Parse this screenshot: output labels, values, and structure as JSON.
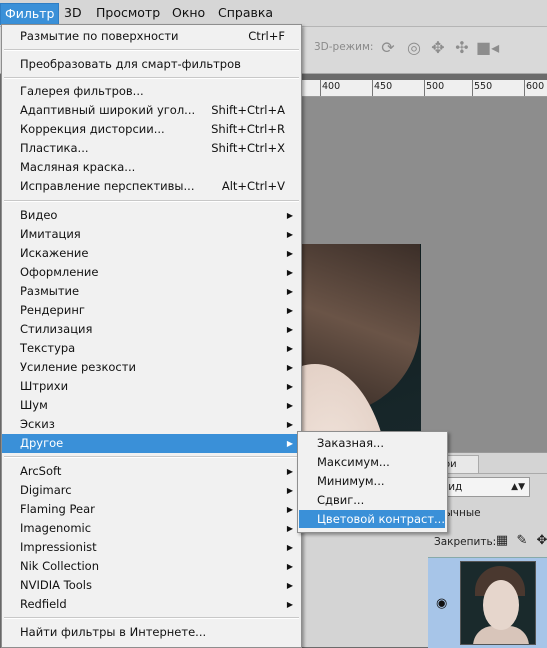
{
  "menubar": {
    "items": [
      "Фильтр",
      "3D",
      "Просмотр",
      "Окно",
      "Справка"
    ]
  },
  "options_bar": {
    "mode_label": "3D-режим:",
    "icons": [
      "rotate-3d-icon",
      "roll-3d-icon",
      "pan-3d-icon",
      "slide-3d-icon",
      "scale-3d-icon"
    ]
  },
  "ruler": {
    "labels": [
      "400",
      "450",
      "500",
      "550",
      "600"
    ]
  },
  "filter_menu": {
    "items": [
      {
        "label": "Размытие по поверхности",
        "shortcut": "Ctrl+F"
      },
      {
        "label": "Преобразовать для смарт-фильтров"
      },
      {
        "label": "Галерея фильтров..."
      },
      {
        "label": "Адаптивный широкий угол...",
        "shortcut": "Shift+Ctrl+A"
      },
      {
        "label": "Коррекция дисторсии...",
        "shortcut": "Shift+Ctrl+R"
      },
      {
        "label": "Пластика...",
        "shortcut": "Shift+Ctrl+X"
      },
      {
        "label": "Масляная краска..."
      },
      {
        "label": "Исправление перспективы...",
        "shortcut": "Alt+Ctrl+V"
      },
      {
        "label": "Видео"
      },
      {
        "label": "Имитация"
      },
      {
        "label": "Искажение"
      },
      {
        "label": "Оформление"
      },
      {
        "label": "Размытие"
      },
      {
        "label": "Рендеринг"
      },
      {
        "label": "Стилизация"
      },
      {
        "label": "Текстура"
      },
      {
        "label": "Усиление резкости"
      },
      {
        "label": "Штрихи"
      },
      {
        "label": "Шум"
      },
      {
        "label": "Эскиз"
      },
      {
        "label": "Другое"
      },
      {
        "label": "ArcSoft"
      },
      {
        "label": "Digimarc"
      },
      {
        "label": "Flaming Pear"
      },
      {
        "label": "Imagenomic"
      },
      {
        "label": "Impressionist"
      },
      {
        "label": "Nik Collection"
      },
      {
        "label": "NVIDIA Tools"
      },
      {
        "label": "Redfield"
      },
      {
        "label": "Найти фильтры в Интернете..."
      }
    ]
  },
  "submenu": {
    "items": [
      "Заказная...",
      "Максимум...",
      "Минимум...",
      "Сдвиг...",
      "Цветовой контраст..."
    ]
  },
  "layers_panel": {
    "tab_label": "ои",
    "kind_select": "Вид",
    "blend_mode": "бычные",
    "lock_label": "Закрепить:"
  },
  "colors": {
    "highlight": "#3a90d8",
    "menu_bg": "#f1f1f1"
  }
}
